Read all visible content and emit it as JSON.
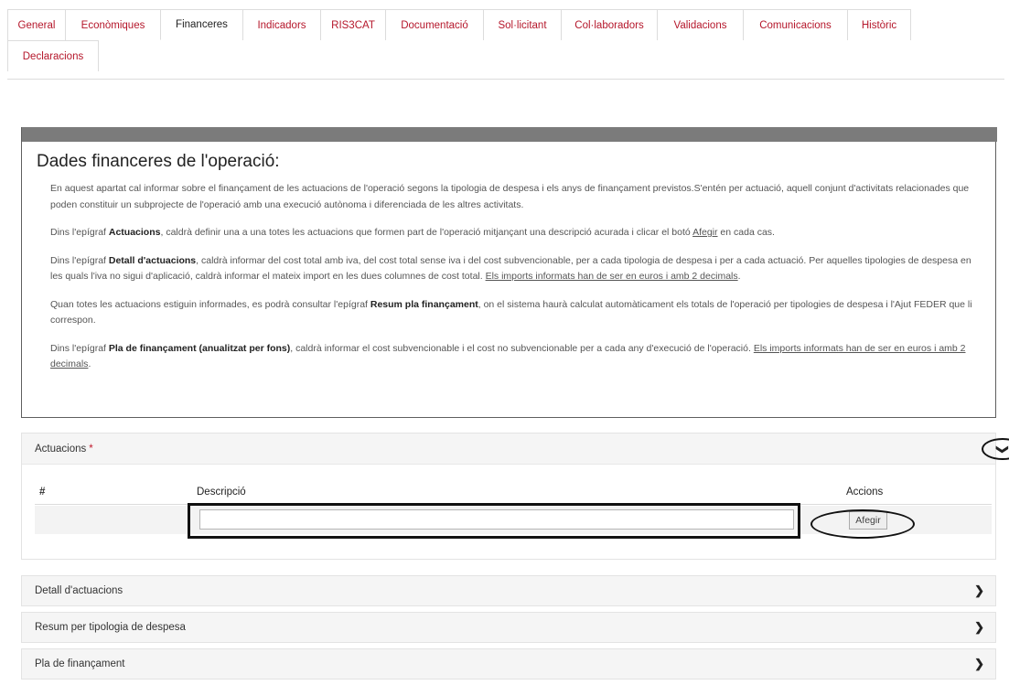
{
  "tabs": {
    "row1": [
      "General",
      "Econòmiques",
      "Financeres",
      "Indicadors",
      "RIS3CAT",
      "Documentació",
      "Sol·licitant",
      "Col·laboradors",
      "Validacions",
      "Comunicacions",
      "Històric"
    ],
    "row2": [
      "Declaracions"
    ],
    "active": "Financeres"
  },
  "info": {
    "title": "Dades financeres de l'operació:",
    "p1": "En aquest apartat cal informar sobre el finançament de les actuacions de l'operació segons la tipologia de despesa i els anys de finançament previstos.S'entén per actuació, aquell conjunt d'activitats relacionades que poden constituir un subprojecte de l'operació amb una execució autònoma i diferenciada de les altres activitats.",
    "p2_a": "Dins l'epígraf ",
    "p2_b": "Actuacions",
    "p2_c": ", caldrà definir una a una totes les actuacions que formen part de l'operació mitjançant una descripció acurada i clicar el botó ",
    "p2_d": "Afegir",
    "p2_e": " en cada cas.",
    "p3_a": "Dins l'epígraf ",
    "p3_b": "Detall d'actuacions",
    "p3_c": ", caldrà informar del cost total amb iva, del cost total sense iva i del cost subvencionable, per a cada tipologia de despesa i per a cada actuació. Per aquelles tipologies de despesa en les quals l'iva no sigui d'aplicació, caldrà informar el mateix import en les dues columnes de cost total. ",
    "p3_d": "Els imports informats han de ser en euros i amb 2 decimals",
    "p3_e": ".",
    "p4_a": "Quan totes les actuacions estiguin informades, es podrà consultar l'epígraf ",
    "p4_b": "Resum pla finançament",
    "p4_c": ", on el sistema haurà calculat automàticament els totals de l'operació per tipologies de despesa i l'Ajut FEDER que li correspon.",
    "p5_a": "Dins l'epígraf ",
    "p5_b": "Pla de finançament (anualitzat per fons)",
    "p5_c": ", caldrà informar el cost subvencionable i el cost no subvencionable per a cada any d'execució de l'operació. ",
    "p5_d": "Els imports informats han de ser en euros i amb 2 decimals",
    "p5_e": "."
  },
  "actuacions": {
    "title": "Actuacions",
    "required_mark": "*",
    "col_num": "#",
    "col_desc": "Descripció",
    "col_actions": "Accions",
    "input_value": "",
    "add_button": "Afegir"
  },
  "sections": {
    "detall": "Detall d'actuacions",
    "resum": "Resum per tipologia de despesa",
    "pla": "Pla de finançament"
  },
  "icons": {
    "expand": "chevron-down-icon",
    "collapsed": "chevron-right-icon"
  }
}
